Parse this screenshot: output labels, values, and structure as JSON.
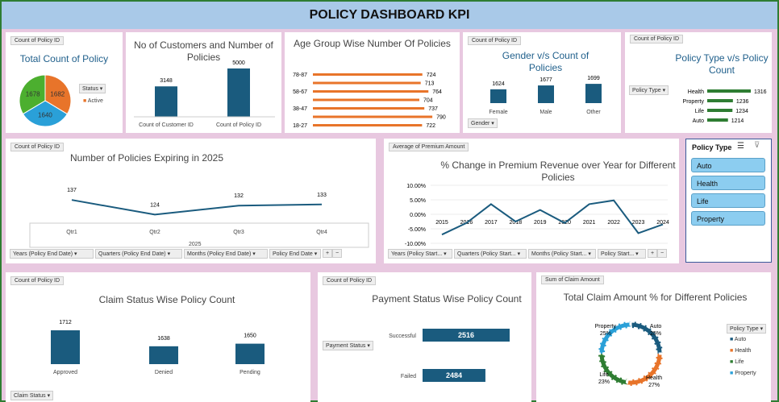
{
  "header": {
    "title": "POLICY DASHBOARD KPI"
  },
  "colors": {
    "bar": "#1a5b7e",
    "orange": "#e8742a",
    "green": "#4caf2f",
    "blue": "#2aa0d8",
    "darkgreen": "#2e7d32"
  },
  "total_policy": {
    "tag": "Count of Policy ID",
    "title": "Total Count of Policy",
    "filter_label": "Status",
    "legend_label": "Active"
  },
  "customers": {
    "title": "No of Customers and Number of Policies"
  },
  "age": {
    "title": "Age Group Wise Number Of Policies"
  },
  "gender": {
    "tag": "Count of Policy ID",
    "title": "Gender v/s Count of Policies",
    "filter_label": "Gender"
  },
  "ptype": {
    "tag": "Count of Policy ID",
    "title": "Policy Type v/s Policy Count",
    "filter_label": "Policy Type"
  },
  "expiring": {
    "tag": "Count of Policy ID",
    "title": "Number of Policies Expiring in 2025",
    "year_label": "2025",
    "filters": [
      "Years (Policy End Date)",
      "Quarters (Policy End Date)",
      "Months (Policy End Date)",
      "Policy End Date"
    ]
  },
  "premium": {
    "tag": "Average of Premium Amount",
    "title": "% Change in Premium Revenue over Year for Different Policies",
    "filters": [
      "Years (Policy Start...",
      "Quarters (Policy Start...",
      "Months (Policy Start...",
      "Policy Start..."
    ]
  },
  "slicer": {
    "title": "Policy Type",
    "items": [
      "Auto",
      "Health",
      "Life",
      "Property"
    ]
  },
  "claim": {
    "tag": "Count of Policy ID",
    "title": "Claim Status Wise Policy Count",
    "filter_label": "Claim Status"
  },
  "payment": {
    "tag": "Count of Policy ID",
    "title": "Payment Status Wise Policy Count",
    "filter_label": "Payment Status"
  },
  "claimamt": {
    "tag": "Sum of Claim Amount",
    "title": "Total Claim Amount % for Different Policies",
    "filter_label": "Policy Type"
  },
  "chart_data": [
    {
      "id": "total",
      "type": "pie",
      "title": "Total Count of Policy",
      "categories": [
        "1682",
        "1640",
        "1678"
      ],
      "values": [
        1682,
        1640,
        1678
      ],
      "colors": [
        "#e8742a",
        "#2aa0d8",
        "#4caf2f"
      ],
      "legend": [
        "Active"
      ]
    },
    {
      "id": "customers",
      "type": "bar",
      "title": "No of Customers and Number of Policies",
      "categories": [
        "Count of Customer ID",
        "Count of Policy ID"
      ],
      "values": [
        3148,
        5000
      ]
    },
    {
      "id": "age",
      "type": "bar",
      "orientation": "horizontal",
      "title": "Age Group Wise Number Of Policies",
      "categories": [
        "78-87",
        "68-77",
        "58-67",
        "48-57",
        "38-47",
        "28-37",
        "18-27"
      ],
      "tick_labels": [
        "78-87",
        "",
        "58-67",
        "",
        "38-47",
        "",
        "18-27"
      ],
      "values": [
        724,
        713,
        764,
        704,
        737,
        790,
        722
      ]
    },
    {
      "id": "gender",
      "type": "bar",
      "title": "Gender v/s Count of Policies",
      "categories": [
        "Female",
        "Male",
        "Other"
      ],
      "values": [
        1624,
        1677,
        1699
      ]
    },
    {
      "id": "ptype",
      "type": "bar",
      "orientation": "horizontal",
      "title": "Policy Type v/s Policy Count",
      "categories": [
        "Health",
        "Property",
        "Life",
        "Auto"
      ],
      "values": [
        1316,
        1236,
        1234,
        1214
      ]
    },
    {
      "id": "expiring",
      "type": "line",
      "title": "Number of Policies Expiring in 2025",
      "categories": [
        "Qtr1",
        "Qtr2",
        "Qtr3",
        "Qtr4"
      ],
      "values": [
        137,
        124,
        132,
        133
      ],
      "xlabel": "2025"
    },
    {
      "id": "premium",
      "type": "line",
      "title": "% Change in Premium Revenue over Year for Different Policies",
      "x": [
        "2015",
        "2016",
        "2017",
        "2018",
        "2019",
        "2020",
        "2021",
        "2022",
        "2023",
        "2024"
      ],
      "y_ticks": [
        "10.00%",
        "5.00%",
        "0.00%",
        "-5.00%",
        "-10.00%"
      ],
      "ylim": [
        -10,
        10
      ],
      "values": [
        -7.0,
        -3.0,
        3.5,
        -2.5,
        1.5,
        -3.0,
        3.5,
        4.8,
        -6.5,
        -3.5
      ]
    },
    {
      "id": "claim",
      "type": "bar",
      "title": "Claim Status Wise Policy Count",
      "categories": [
        "Approved",
        "Denied",
        "Pending"
      ],
      "values": [
        1712,
        1638,
        1650
      ]
    },
    {
      "id": "payment",
      "type": "bar",
      "orientation": "horizontal",
      "title": "Payment Status Wise Policy Count",
      "categories": [
        "Successful",
        "Failed"
      ],
      "values": [
        2516,
        2484
      ]
    },
    {
      "id": "claimamt",
      "type": "pie",
      "donut": true,
      "title": "Total Claim Amount % for Different Policies",
      "categories": [
        "Auto",
        "Health",
        "Life",
        "Property"
      ],
      "values": [
        25,
        27,
        23,
        25
      ],
      "colors": [
        "#1a5b7e",
        "#e8742a",
        "#2e7d32",
        "#2aa0d8"
      ]
    }
  ]
}
